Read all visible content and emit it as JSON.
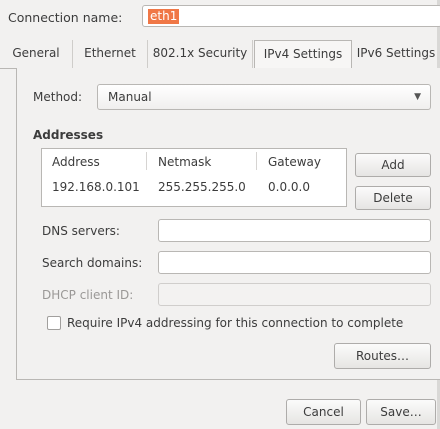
{
  "connection": {
    "label": "Connection name:",
    "value": "eth1"
  },
  "tabs": [
    {
      "label": "General"
    },
    {
      "label": "Ethernet"
    },
    {
      "label": "802.1x Security"
    },
    {
      "label": "IPv4 Settings"
    },
    {
      "label": "IPv6 Settings"
    }
  ],
  "active_tab": "IPv4 Settings",
  "method": {
    "label": "Method:",
    "value": "Manual",
    "icon": "chevron-down-icon"
  },
  "addresses": {
    "heading": "Addresses",
    "columns": [
      "Address",
      "Netmask",
      "Gateway"
    ],
    "rows": [
      [
        "192.168.0.101",
        "255.255.255.0",
        "0.0.0.0"
      ]
    ],
    "add_label": "Add",
    "delete_label": "Delete"
  },
  "dns_servers": {
    "label": "DNS servers:",
    "value": ""
  },
  "search_domains": {
    "label": "Search domains:",
    "value": ""
  },
  "dhcp_client_id": {
    "label": "DHCP client ID:",
    "value": ""
  },
  "require_ipv4": {
    "label": "Require IPv4 addressing for this connection to complete",
    "checked": false
  },
  "routes_label": "Routes…",
  "footer": {
    "cancel_label": "Cancel",
    "save_label": "Save…"
  }
}
